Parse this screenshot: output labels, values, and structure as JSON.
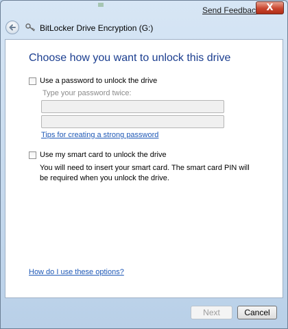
{
  "window": {
    "title": "BitLocker Drive Encryption (G:)",
    "send_feedback": "Send Feedback",
    "close_glyph": "X",
    "back_icon": "back-arrow-icon",
    "title_icon": "bitlocker-key-icon"
  },
  "page": {
    "heading": "Choose how you want to unlock this drive",
    "password_option": {
      "label": "Use a password to unlock the drive",
      "checked": false,
      "prompt": "Type your password twice:",
      "field1_value": "",
      "field2_value": "",
      "tips_link": "Tips for creating a strong password"
    },
    "smartcard_option": {
      "label": "Use my smart card to unlock the drive",
      "checked": false,
      "description": "You will need to insert your smart card. The smart card PIN will be required when you unlock the drive."
    },
    "help_link": "How do I use these options?"
  },
  "footer": {
    "next_label": "Next",
    "next_enabled": false,
    "cancel_label": "Cancel"
  },
  "colors": {
    "heading": "#1a3d8f",
    "link": "#1e58b6",
    "close_button": "#c9462f"
  }
}
